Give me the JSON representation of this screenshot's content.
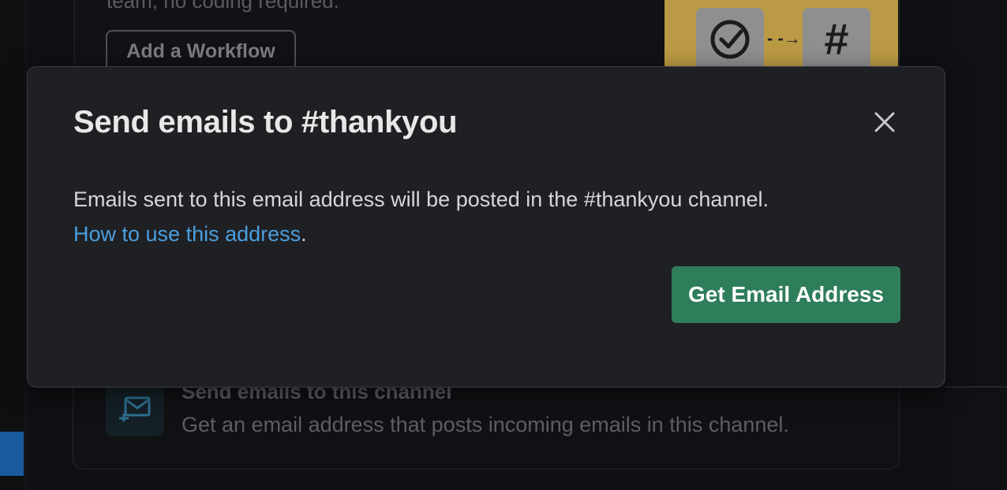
{
  "background": {
    "top_card": {
      "text": "team, no coding required.",
      "add_workflow_label": "Add a Workflow",
      "illustration_symbol": "#"
    },
    "bottom_card": {
      "title": "Send emails to this channel",
      "description": "Get an email address that posts incoming emails in this channel.",
      "icon": "mail-icon"
    }
  },
  "modal": {
    "title": "Send emails to #thankyou",
    "close_icon": "close-icon",
    "body_text": "Emails sent to this email address will be posted in the #thankyou channel.",
    "link_text": "How to use this address",
    "link_suffix": ".",
    "primary_button_label": "Get Email Address"
  },
  "colors": {
    "modal_bg": "#1f2023",
    "link": "#4a9ede",
    "primary_button": "#2e7d5b",
    "illustration_bg": "#bb9a45"
  }
}
